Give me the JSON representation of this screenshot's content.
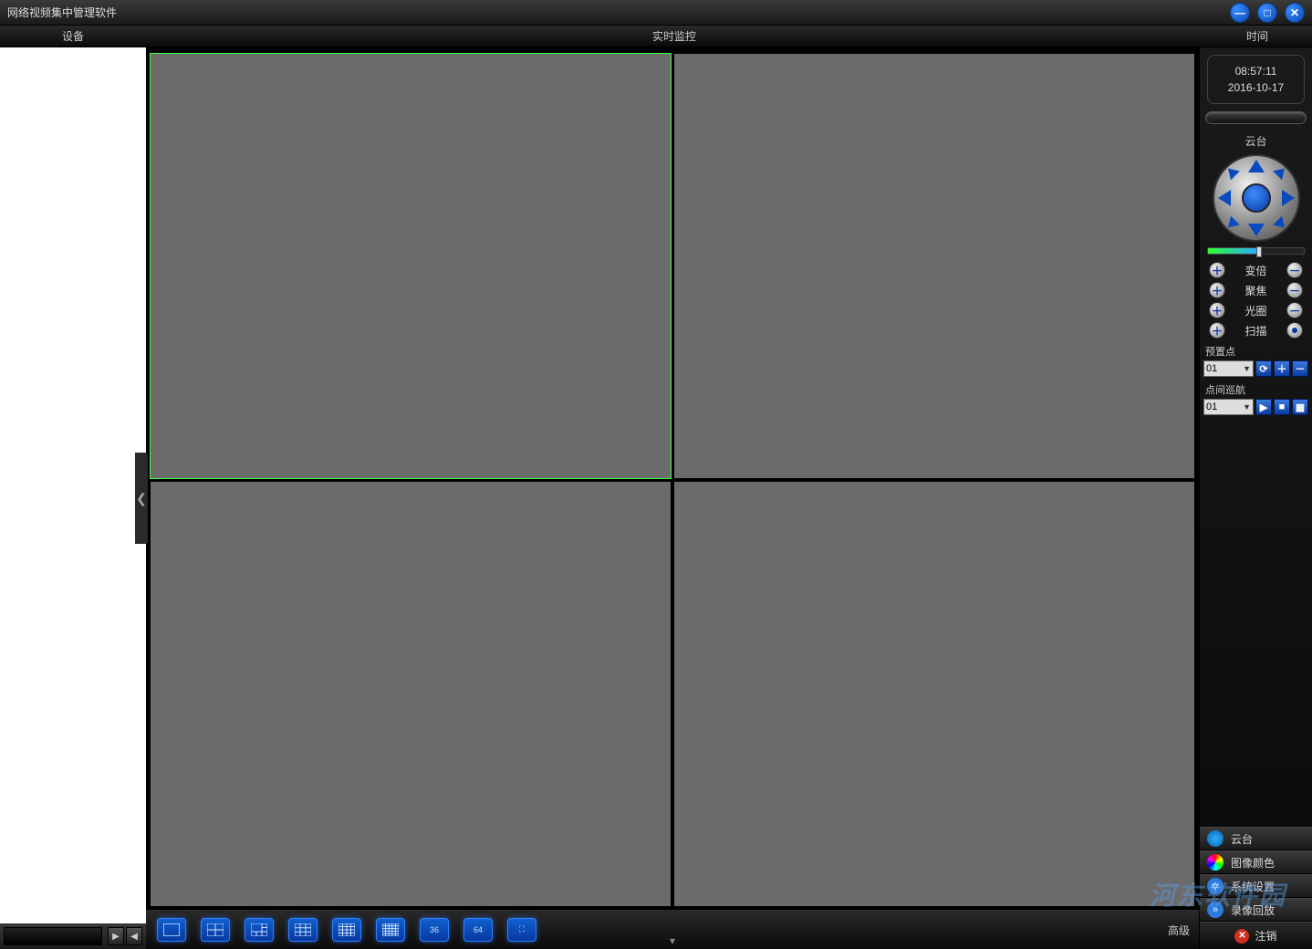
{
  "app": {
    "title": "网络视频集中管理软件"
  },
  "headers": {
    "left": "设备",
    "center": "实时监控",
    "right": "时间"
  },
  "clock": {
    "time": "08:57:11",
    "date": "2016-10-17"
  },
  "ptz": {
    "title": "云台",
    "zoom": "变倍",
    "focus": "聚焦",
    "iris": "光圈",
    "scan": "扫描",
    "preset_label": "预置点",
    "preset_value": "01",
    "cruise_label": "点间巡航",
    "cruise_value": "01"
  },
  "layout_buttons": {
    "b1": "1",
    "b4": "4",
    "b6": "6",
    "b9": "9",
    "b16": "16",
    "b25": "25",
    "b36": "36",
    "b64": "64",
    "full": "⛶"
  },
  "bottom_right": "高级",
  "menu": {
    "ptz": "云台",
    "image_color": "图像颜色",
    "system_settings": "系统设置",
    "playback": "录像回放",
    "logout": "注销"
  },
  "glyphs": {
    "minimize": "—",
    "maximize": "□",
    "close": "✕",
    "plus": "＋",
    "minus": "－",
    "dot": "●",
    "goto": "⟳",
    "add": "＋",
    "del": "－",
    "play": "▶",
    "stop": "■",
    "grid": "▦",
    "chevron_left": "◀",
    "chevron_right": "▶",
    "collapse": "❮",
    "chevron_down": "▾",
    "gear": "✲",
    "film": "»"
  },
  "watermark": "河东软件园"
}
